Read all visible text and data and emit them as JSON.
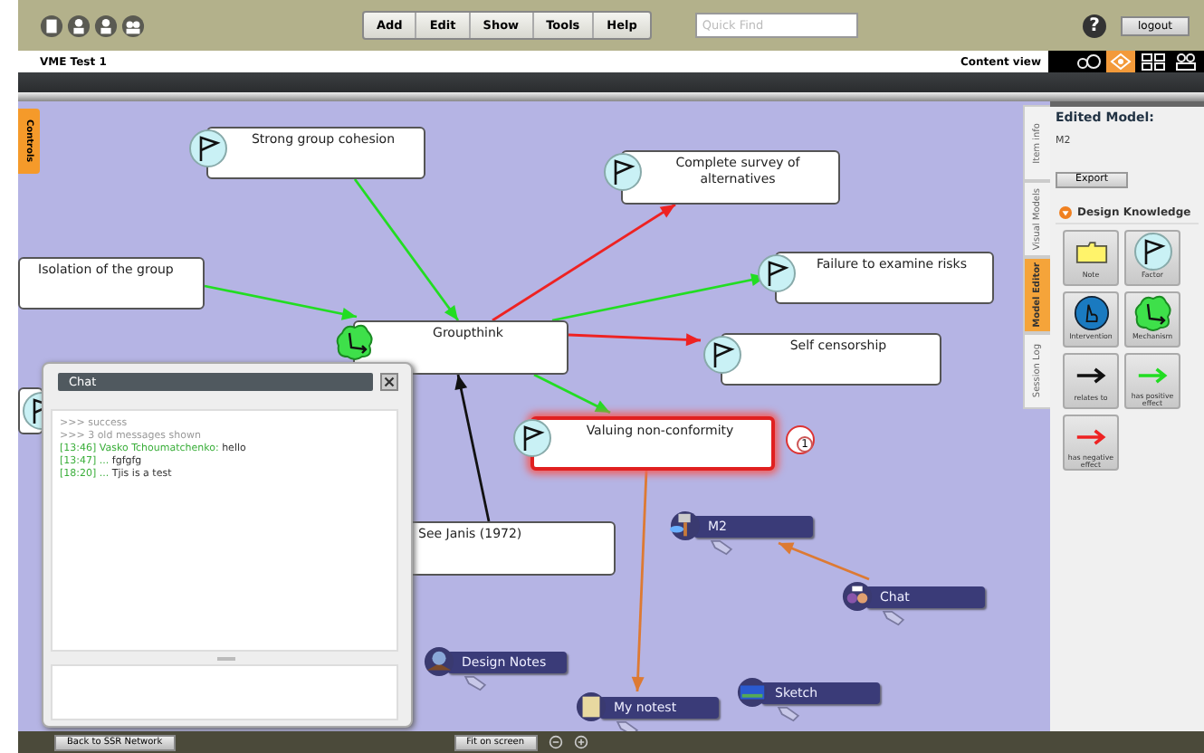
{
  "toolbar": {
    "menus": [
      "Add",
      "Edit",
      "Show",
      "Tools",
      "Help"
    ],
    "search": {
      "placeholder": "Quick Find"
    },
    "help": "?",
    "logout": "logout"
  },
  "title_bar": {
    "title": "VME Test 1",
    "view_label": "Content view",
    "view_modes": [
      {
        "kind": "glasses",
        "selected": false
      },
      {
        "kind": "network",
        "selected": true
      },
      {
        "kind": "grid",
        "selected": false
      },
      {
        "kind": "people",
        "selected": false
      }
    ]
  },
  "left_tab": "Controls",
  "canvas": {
    "nodes": [
      {
        "kind": "factor",
        "label": "Strong group cohesion",
        "selected": false
      },
      {
        "kind": "factor",
        "label": "Complete survey of alternatives",
        "selected": false
      },
      {
        "label": "Isolation of the group",
        "selected": false
      },
      {
        "kind": "mechanism",
        "label": "Groupthink",
        "selected": false
      },
      {
        "kind": "factor",
        "label": "Failure to examine risks",
        "selected": false
      },
      {
        "kind": "factor",
        "label": "Self censorship",
        "selected": false
      },
      {
        "kind": "factor",
        "label": "Valuing non-conformity",
        "selected": true,
        "notes": "1"
      },
      {
        "label": "See Janis (1972)",
        "selected": false
      },
      {
        "kind": "factor",
        "selected": false
      }
    ],
    "links": [
      {
        "kind": "positive"
      },
      {
        "kind": "positive"
      },
      {
        "kind": "negative"
      },
      {
        "kind": "positive"
      },
      {
        "kind": "negative"
      },
      {
        "kind": "positive"
      },
      {
        "kind": "relates"
      },
      {
        "kind": "resource"
      },
      {
        "kind": "resource"
      }
    ],
    "resources": [
      {
        "kind": "model",
        "label": "M2"
      },
      {
        "kind": "chat",
        "label": "Chat"
      },
      {
        "kind": "notes",
        "label": "Design Notes"
      },
      {
        "kind": "document",
        "label": "My notest"
      },
      {
        "kind": "sketch",
        "label": "Sketch"
      }
    ]
  },
  "chat": {
    "title": "Chat",
    "messages": [
      {
        "kind": "system",
        "text": ">>> success"
      },
      {
        "kind": "system",
        "text": ">>> 3 old messages shown"
      },
      {
        "kind": "user",
        "time": "[13:46]",
        "author": "Vasko Tchoumatchenko:",
        "text": "hello"
      },
      {
        "kind": "user",
        "time": "[13:47]",
        "author": "...",
        "text": "fgfgfg"
      },
      {
        "kind": "user",
        "time": "[18:20]",
        "author": "...",
        "text": "Tjis is a test"
      }
    ]
  },
  "side_tabs": [
    {
      "label": "Item info",
      "selected": false
    },
    {
      "label": "Visual Models",
      "selected": false
    },
    {
      "label": "Model Editor",
      "selected": true
    },
    {
      "label": "Session Log",
      "selected": false
    }
  ],
  "edited_model": {
    "heading": "Edited Model:",
    "name": "M2",
    "export": "Export"
  },
  "design_knowledge": {
    "title": "Design Knowledge",
    "items": [
      {
        "kind": "note",
        "label": "Note"
      },
      {
        "kind": "factor",
        "label": "Factor"
      },
      {
        "kind": "intervention",
        "label": "Intervention"
      },
      {
        "kind": "mechanism",
        "label": "Mechanism"
      },
      {
        "kind": "relates",
        "label": "relates to"
      },
      {
        "kind": "positive",
        "label": "has positive effect"
      },
      {
        "kind": "negative",
        "label": "has negative effect"
      }
    ]
  },
  "bottom_bar": {
    "buttons": [
      "Back to SSR Network",
      "Fit on screen"
    ]
  }
}
